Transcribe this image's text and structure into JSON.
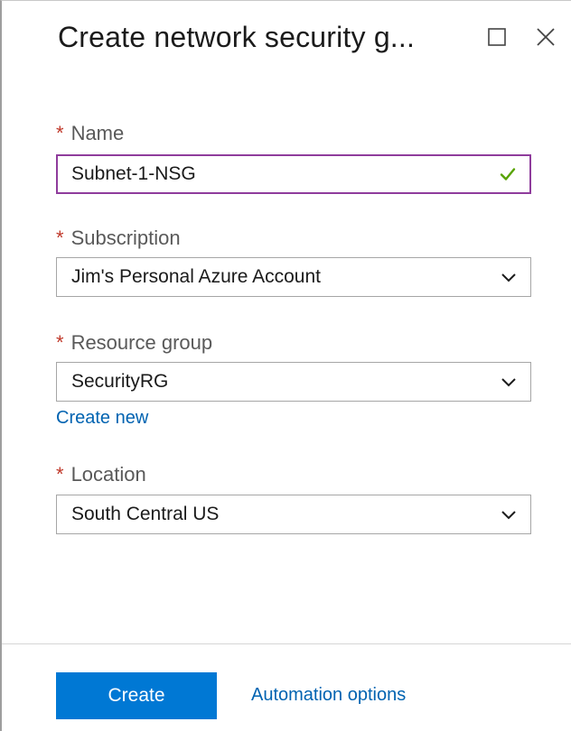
{
  "header": {
    "title": "Create network security g..."
  },
  "form": {
    "name": {
      "required_mark": "*",
      "label": "Name",
      "value": "Subnet-1-NSG"
    },
    "subscription": {
      "required_mark": "*",
      "label": "Subscription",
      "value": "Jim's Personal Azure Account"
    },
    "resource_group": {
      "required_mark": "*",
      "label": "Resource group",
      "value": "SecurityRG",
      "create_new_link": "Create new"
    },
    "location": {
      "required_mark": "*",
      "label": "Location",
      "value": "South Central US"
    }
  },
  "footer": {
    "create_label": "Create",
    "automation_label": "Automation options"
  },
  "icons": {
    "maximize": "maximize-icon",
    "close": "close-icon",
    "valid": "checkmark-icon",
    "dropdown": "chevron-down-icon"
  },
  "colors": {
    "accent": "#0078d4",
    "link": "#0063b1",
    "focus_border": "#8f3c9c",
    "valid_check": "#57a300",
    "required": "#c0392b"
  }
}
